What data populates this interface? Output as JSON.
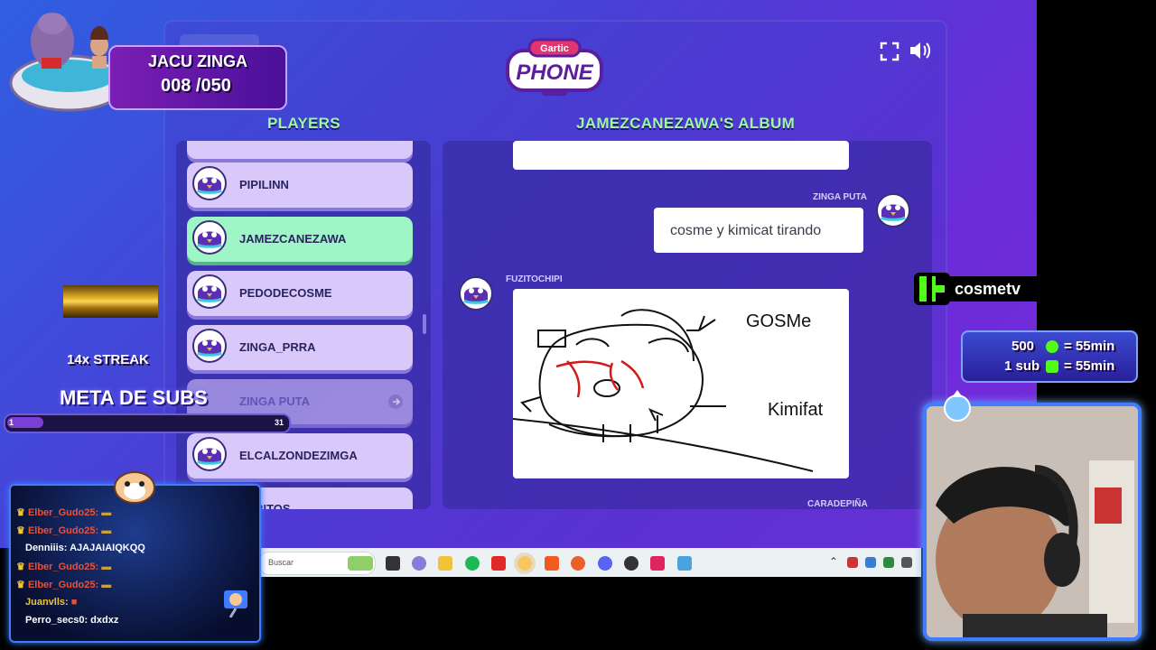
{
  "overlay": {
    "jacu_title": "JACU ZINGA",
    "jacu_count": "008 /050",
    "streak": "14x STREAK",
    "meta_subs": "META DE SUBS",
    "subs_bar_left": "1",
    "subs_bar_right": "31",
    "kick_channel": "cosmetv",
    "sub_info_line1": "500",
    "sub_info_line1_suffix": "= 55min",
    "sub_info_line2": "1 sub",
    "sub_info_line2_suffix": "= 55min"
  },
  "game": {
    "logo_top": "Gartic",
    "logo_bottom": "PHONE",
    "players_header": "PLAYERS",
    "album_header": "JAMEZCANEZAWA'S ALBUM",
    "players": [
      {
        "name": "PIPILINN",
        "state": "normal"
      },
      {
        "name": "JAMEZCANEZAWA",
        "state": "active"
      },
      {
        "name": "PEDODECOSME",
        "state": "normal"
      },
      {
        "name": "ZINGA_PRRA",
        "state": "normal"
      },
      {
        "name": "ZINGA PUTA",
        "state": "disconnected"
      },
      {
        "name": "ELCALZONDEZIMGA",
        "state": "normal"
      },
      {
        "name": "PARITOS",
        "state": "normal"
      }
    ],
    "album": {
      "msg1_user": "ZINGA PUTA",
      "msg1_text": "cosme y kimicat tirando",
      "msg2_user": "FUZITOCHIPI",
      "drawing_label1": "GOSMe",
      "drawing_label2": "Kimifat",
      "msg3_user": "CARADEPIÑA"
    }
  },
  "chat": {
    "lines": [
      {
        "user": "Elber_Gudo25:",
        "text": "",
        "color": "#e8523a"
      },
      {
        "user": "Elber_Gudo25:",
        "text": "",
        "color": "#e8523a"
      },
      {
        "user": "Denniiis:",
        "text": "AJAJAIAIQKQQ",
        "color": "#ffffff"
      },
      {
        "user": "Elber_Gudo25:",
        "text": "",
        "color": "#e8523a"
      },
      {
        "user": "Elber_Gudo25:",
        "text": "",
        "color": "#e8523a"
      },
      {
        "user": "Juanvlls:",
        "text": "",
        "color": "#f2c23a"
      },
      {
        "user": "Perro_secs0:",
        "text": "dxdxz",
        "color": "#ffffff"
      }
    ]
  },
  "taskbar": {
    "search_placeholder": "Buscar"
  }
}
